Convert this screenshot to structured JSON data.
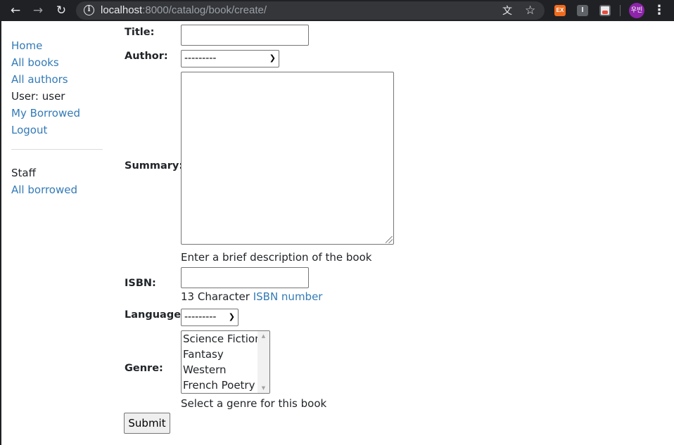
{
  "browser": {
    "url_host": "localhost",
    "url_path": ":8000/catalog/book/create/",
    "profile_initials": "우빈",
    "extension_1_text": "EX",
    "extension_2_text": "I"
  },
  "sidebar": {
    "items": [
      {
        "label": "Home",
        "link": true
      },
      {
        "label": "All books",
        "link": true
      },
      {
        "label": "All authors",
        "link": true
      },
      {
        "label": "User: user",
        "link": false
      },
      {
        "label": "My Borrowed",
        "link": true
      },
      {
        "label": "Logout",
        "link": true
      }
    ],
    "staff_heading": "Staff",
    "staff_items": [
      {
        "label": "All borrowed",
        "link": true
      }
    ]
  },
  "form": {
    "title_label": "Title:",
    "title_value": "",
    "author_label": "Author:",
    "author_selected": "---------",
    "summary_label": "Summary:",
    "summary_value": "",
    "summary_help": "Enter a brief description of the book",
    "isbn_label": "ISBN:",
    "isbn_value": "",
    "isbn_help_prefix": "13 Character",
    "isbn_help_link": "ISBN number",
    "language_label": "Language:",
    "language_selected": "---------",
    "genre_label": "Genre:",
    "genre_options": [
      "Science Fiction",
      "Fantasy",
      "Western",
      "French Poetry"
    ],
    "genre_help": "Select a genre for this book",
    "submit_label": "Submit"
  },
  "colors": {
    "link": "#337ab7",
    "text": "#212529",
    "chrome_bg": "#202124"
  }
}
